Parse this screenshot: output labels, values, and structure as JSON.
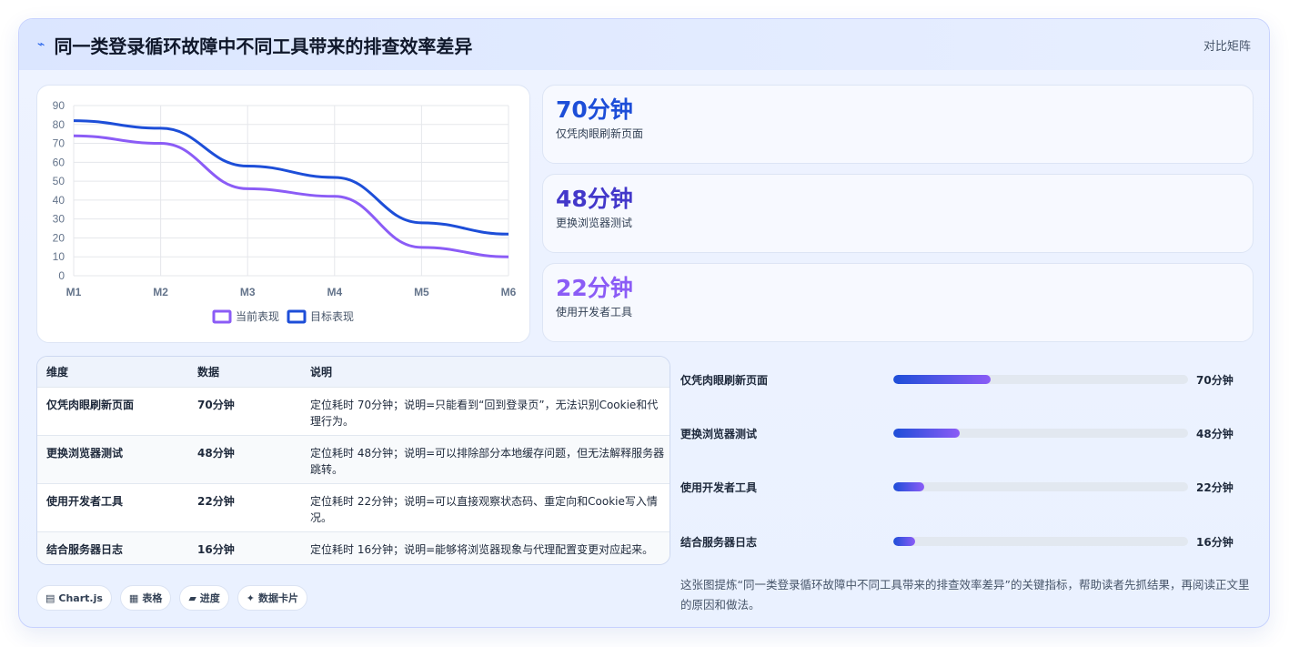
{
  "header": {
    "title": "同一类登录循环故障中不同工具带来的排查效率差异",
    "tag": "对比矩阵"
  },
  "chart_data": {
    "type": "line",
    "categories": [
      "M1",
      "M2",
      "M3",
      "M4",
      "M5",
      "M6"
    ],
    "series": [
      {
        "name": "当前表现",
        "values": [
          74,
          70,
          46,
          42,
          15,
          10
        ],
        "color": "#8b5cf6"
      },
      {
        "name": "目标表现",
        "values": [
          82,
          78,
          58,
          52,
          28,
          22
        ],
        "color": "#1d4ed8"
      }
    ],
    "yticks": [
      "0",
      "10",
      "20",
      "30",
      "40",
      "50",
      "60",
      "70",
      "80",
      "90"
    ],
    "ylim": [
      0,
      90
    ],
    "grid": true,
    "legend": "bottom"
  },
  "kpis": [
    {
      "value": "70分钟",
      "label": "仅凭肉眼刷新页面",
      "color": "#1d4ed8"
    },
    {
      "value": "48分钟",
      "label": "更换浏览器测试",
      "color": "#4338ca"
    },
    {
      "value": "22分钟",
      "label": "使用开发者工具",
      "color": "#8b5cf6"
    }
  ],
  "table": {
    "headers": [
      "维度",
      "数据",
      "说明"
    ],
    "rows": [
      {
        "dim": "仅凭肉眼刷新页面",
        "data": "70分钟",
        "desc": "定位耗时 70分钟；说明=只能看到“回到登录页”，无法识别Cookie和代理行为。"
      },
      {
        "dim": "更换浏览器测试",
        "data": "48分钟",
        "desc": "定位耗时 48分钟；说明=可以排除部分本地缓存问题，但无法解释服务器跳转。"
      },
      {
        "dim": "使用开发者工具",
        "data": "22分钟",
        "desc": "定位耗时 22分钟；说明=可以直接观察状态码、重定向和Cookie写入情况。"
      },
      {
        "dim": "结合服务器日志",
        "data": "16分钟",
        "desc": "定位耗时 16分钟；说明=能够将浏览器现象与代理配置变更对应起来。"
      }
    ]
  },
  "progress": [
    {
      "name": "仅凭肉眼刷新页面",
      "value": "70分钟",
      "fraction": 0.33
    },
    {
      "name": "更换浏览器测试",
      "value": "48分钟",
      "fraction": 0.225
    },
    {
      "name": "使用开发者工具",
      "value": "22分钟",
      "fraction": 0.105
    },
    {
      "name": "结合服务器日志",
      "value": "16分钟",
      "fraction": 0.075
    }
  ],
  "note": "这张图提炼“同一类登录循环故障中不同工具带来的排查效率差异”的关键指标，帮助读者先抓结果，再阅读正文里的原因和做法。",
  "chips": [
    {
      "icon": "bar-chart-icon",
      "glyph": "▤",
      "label": "Chart.js"
    },
    {
      "icon": "table-icon",
      "glyph": "▦",
      "label": "表格"
    },
    {
      "icon": "progress-icon",
      "glyph": "▰",
      "label": "进度"
    },
    {
      "icon": "sparkle-icon",
      "glyph": "✦",
      "label": "数据卡片"
    }
  ]
}
